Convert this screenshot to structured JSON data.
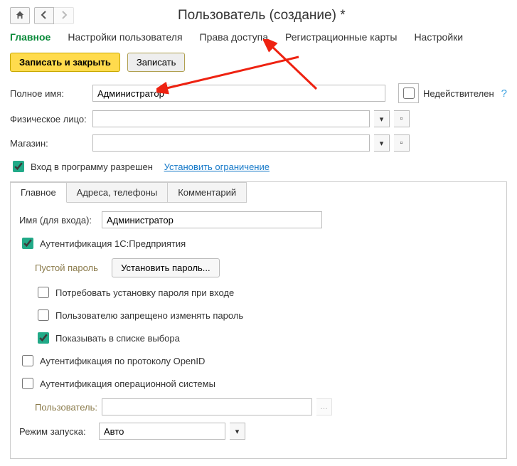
{
  "title": "Пользователь (создание) *",
  "topTabs": {
    "main": "Главное",
    "userSettings": "Настройки пользователя",
    "accessRights": "Права доступа",
    "regCards": "Регистрационные карты",
    "settings": "Настройки"
  },
  "buttons": {
    "saveClose": "Записать и закрыть",
    "save": "Записать"
  },
  "fullName": {
    "label": "Полное имя:",
    "value": "Администратор"
  },
  "invalid": {
    "label": "Недействителен"
  },
  "person": {
    "label": "Физическое лицо:",
    "value": ""
  },
  "store": {
    "label": "Магазин:",
    "value": ""
  },
  "loginAllowed": {
    "label": "Вход в программу разрешен"
  },
  "setRestriction": "Установить ограничение",
  "innerTabs": {
    "main": "Главное",
    "addr": "Адреса, телефоны",
    "comment": "Комментарий"
  },
  "loginName": {
    "label": "Имя (для входа):",
    "value": "Администратор"
  },
  "auth1c": {
    "label": "Аутентификация 1С:Предприятия"
  },
  "emptyPassword": "Пустой пароль",
  "setPassword": "Установить пароль...",
  "requirePwChange": "Потребовать установку пароля при входе",
  "forbidPwChange": "Пользователю запрещено изменять пароль",
  "showInList": "Показывать в списке выбора",
  "authOpenId": "Аутентификация по протоколу OpenID",
  "authOS": "Аутентификация операционной системы",
  "osUser": {
    "label": "Пользователь:",
    "value": ""
  },
  "runMode": {
    "label": "Режим запуска:",
    "value": "Авто"
  }
}
